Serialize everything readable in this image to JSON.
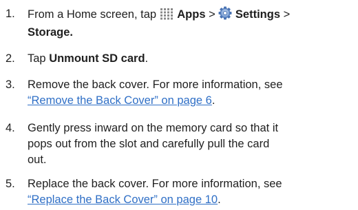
{
  "steps": [
    {
      "num": "1.",
      "pre": "From a Home screen, tap ",
      "apps_label": "Apps",
      "sep1": " > ",
      "settings_label": "Settings",
      "sep2": " >",
      "storage_label": "Storage.",
      "apps_icon": "apps-grid-icon",
      "settings_icon": "settings-gear-icon"
    },
    {
      "num": "2.",
      "pre": "Tap ",
      "bold": "Unmount SD card",
      "post": "."
    },
    {
      "num": "3.",
      "text": "Remove the back cover. For more information, see",
      "link": "“Remove the Back Cover” on page 6",
      "post": "."
    },
    {
      "num": "4.",
      "line1": "Gently press inward on the memory card so that it",
      "line2": "pops out from the slot and carefully pull the card",
      "line3": "out."
    },
    {
      "num": "5.",
      "text": "Replace the back cover. For more information, see",
      "link": "“Replace the Back Cover” on page 10",
      "post": "."
    }
  ],
  "colors": {
    "text": "#1f1f1f",
    "link": "#2f6fc6"
  }
}
